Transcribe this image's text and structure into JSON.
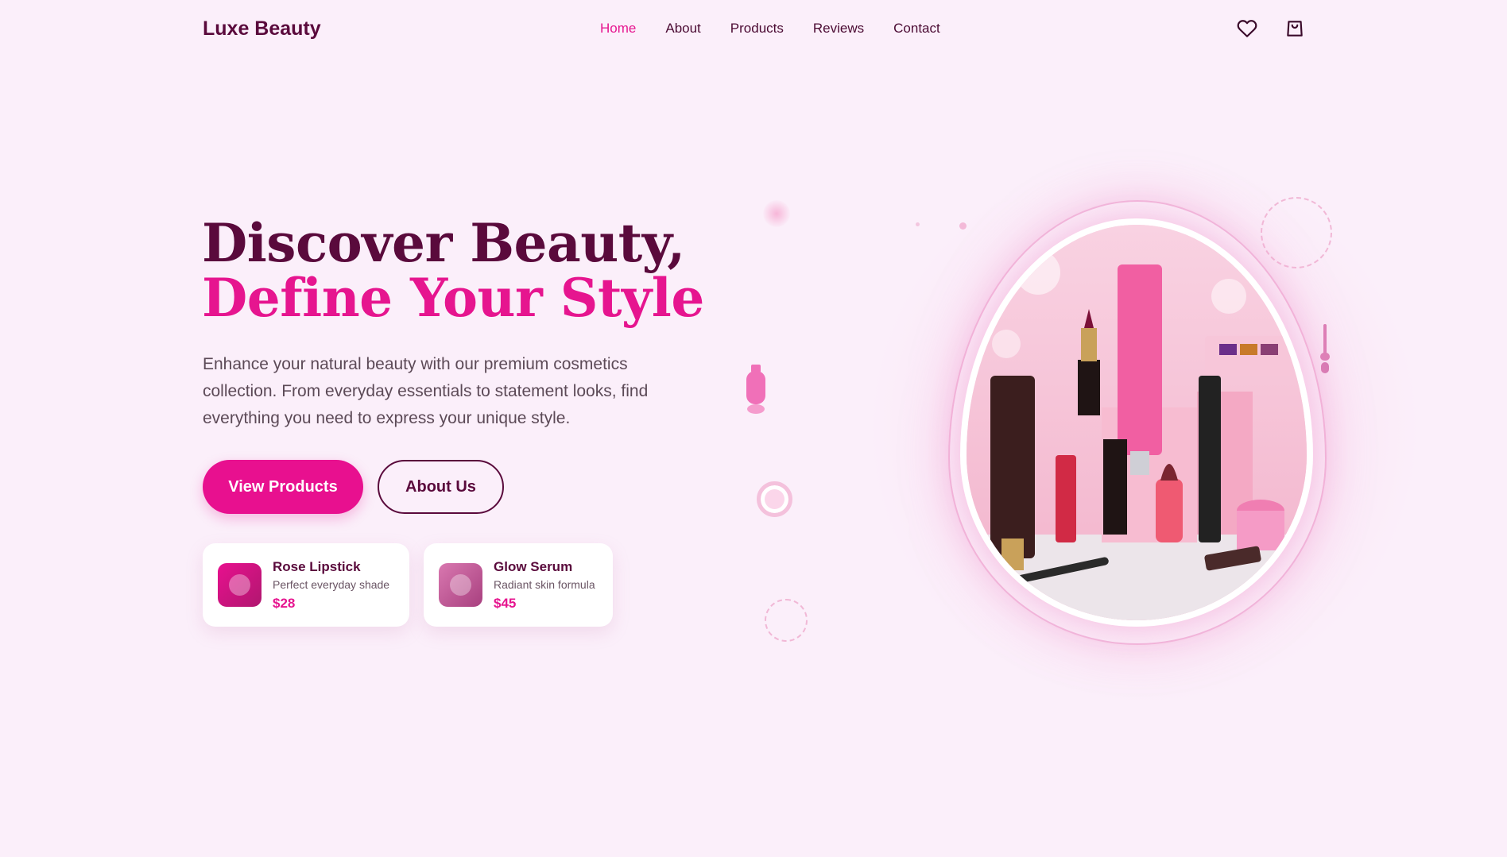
{
  "brand": {
    "name": "Luxe Beauty"
  },
  "nav": {
    "items": [
      {
        "label": "Home",
        "active": true
      },
      {
        "label": "About",
        "active": false
      },
      {
        "label": "Products",
        "active": false
      },
      {
        "label": "Reviews",
        "active": false
      },
      {
        "label": "Contact",
        "active": false
      }
    ]
  },
  "header_icons": [
    "heart-icon",
    "shopping-bag-icon"
  ],
  "hero": {
    "title_line1": "Discover Beauty,",
    "title_line2": "Define Your Style",
    "description": "Enhance your natural beauty with our premium cosmetics collection. From everyday essentials to statement looks, find everything you need to express your unique style.",
    "primary_button": "View Products",
    "secondary_button": "About Us"
  },
  "products": [
    {
      "name": "Rose Lipstick",
      "description": "Perfect everyday shade",
      "price": "$28",
      "color_from": "#e8108f",
      "color_to": "#b0176f"
    },
    {
      "name": "Glow Serum",
      "description": "Radiant skin formula",
      "price": "$45",
      "color_from": "#d978b0",
      "color_to": "#a8407f"
    }
  ],
  "colors": {
    "background": "#fbeffa",
    "primary": "#e6158f",
    "dark": "#5a0a3c",
    "text_muted": "#5c4a57"
  }
}
